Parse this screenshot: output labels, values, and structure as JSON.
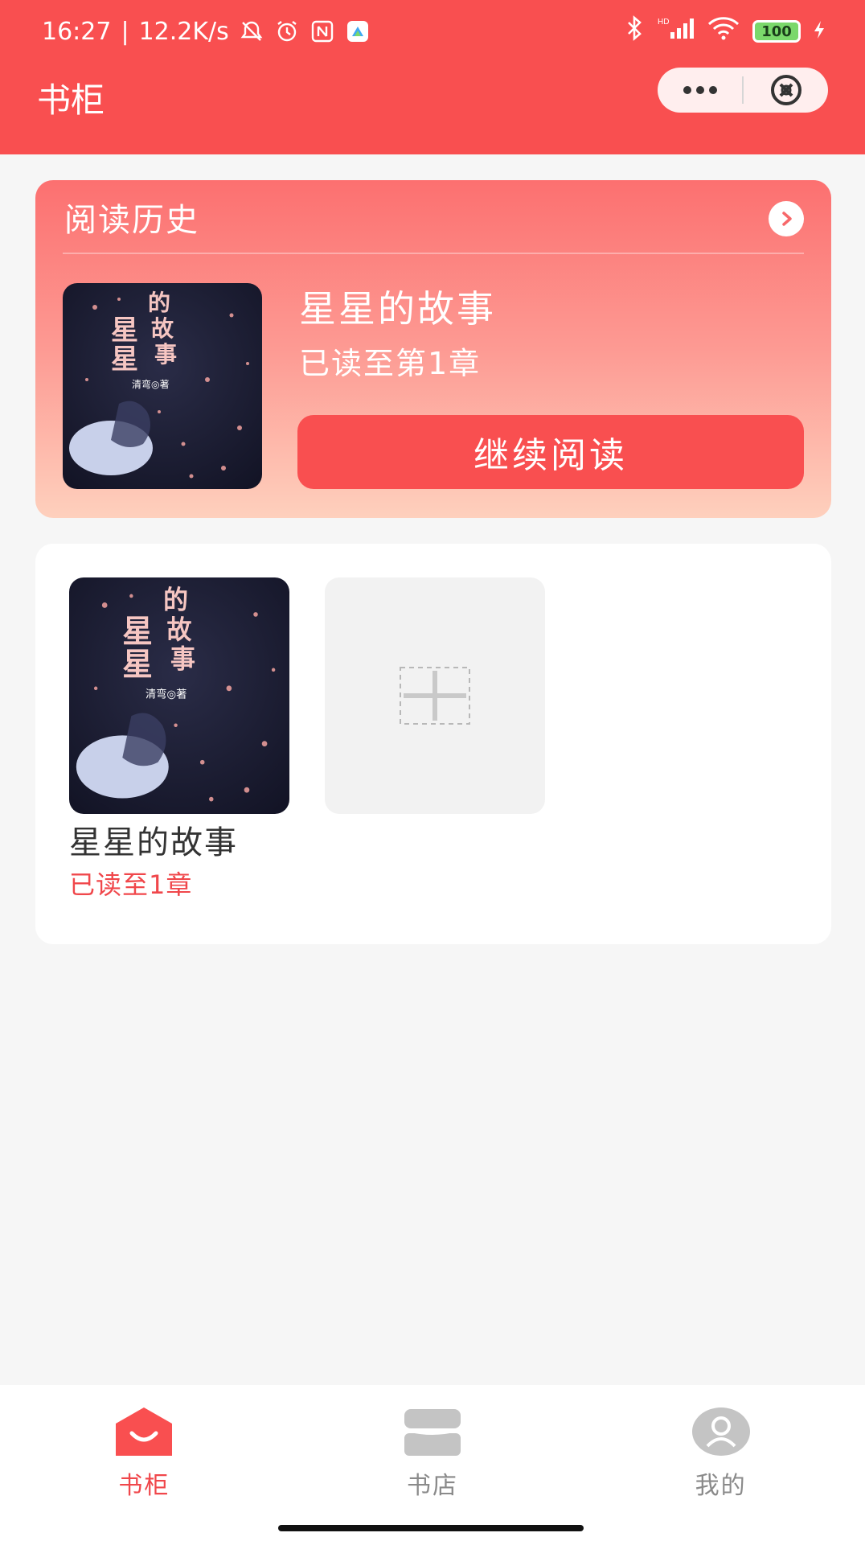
{
  "status_bar": {
    "time": "16:27",
    "speed": "12.2K/s",
    "battery": "100",
    "signal_label": "HD",
    "icons": [
      "mute-bell-icon",
      "alarm-icon",
      "nfc-icon",
      "app-notification-icon",
      "bluetooth-icon",
      "signal-icon",
      "wifi-icon",
      "battery-icon",
      "charging-icon"
    ]
  },
  "header": {
    "title": "书柜",
    "capsule": {
      "more_icon": "more-dots-icon",
      "close_icon": "close-circle-icon"
    }
  },
  "history": {
    "title": "阅读历史",
    "book_title": "星星的故事",
    "progress": "已读至第1章",
    "continue_label": "继续阅读",
    "arrow_icon": "chevron-right-icon"
  },
  "cover": {
    "char_xing": "星",
    "char_de": "的",
    "char_gu": "故",
    "char_shi": "事",
    "author": "清弯◎著"
  },
  "shelf": {
    "books": [
      {
        "title": "星星的故事",
        "progress": "已读至1章"
      }
    ],
    "add_icon": "add-book-icon"
  },
  "tabs": [
    {
      "label": "书柜",
      "icon": "bookshelf-icon",
      "active": true
    },
    {
      "label": "书店",
      "icon": "store-icon",
      "active": false
    },
    {
      "label": "我的",
      "icon": "user-icon",
      "active": false
    }
  ],
  "colors": {
    "brand": "#f94f50",
    "accent_text": "#f0474b",
    "inactive_tab": "#8a8a8a"
  }
}
